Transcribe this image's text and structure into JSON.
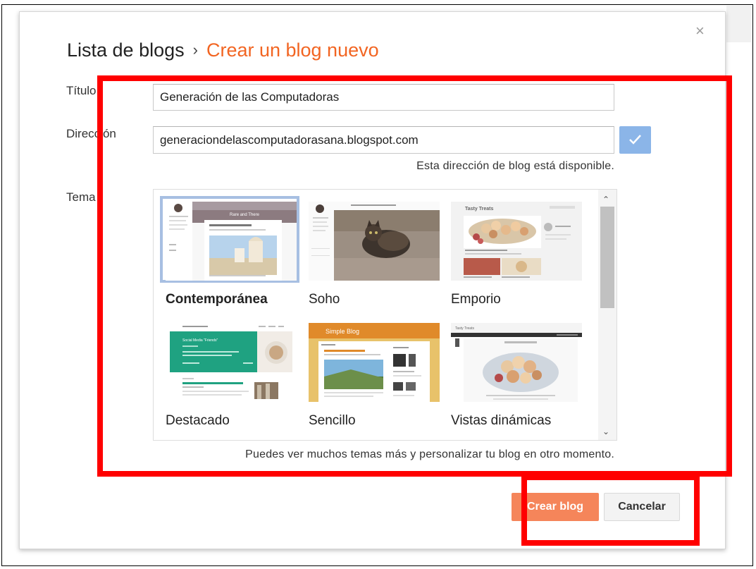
{
  "dialog": {
    "breadcrumb": {
      "parent": "Lista de blogs",
      "separator": "›",
      "current": "Crear un blog nuevo"
    },
    "close_icon": "×",
    "fields": {
      "title_label": "Título",
      "title_value": "Generación de las Computadoras",
      "address_label": "Dirección",
      "address_value": "generaciondelascomputadorasana.blogspot.com",
      "availability": "Esta dirección de blog está disponible.",
      "theme_label": "Tema"
    },
    "themes": [
      {
        "name": "Contemporánea",
        "selected": true
      },
      {
        "name": "Soho",
        "selected": false
      },
      {
        "name": "Emporio",
        "selected": false
      },
      {
        "name": "Destacado",
        "selected": false
      },
      {
        "name": "Sencillo",
        "selected": false
      },
      {
        "name": "Vistas dinámicas",
        "selected": false
      }
    ],
    "theme_thumbs": {
      "contemporanea_heading": "Rare and There",
      "emporio_heading": "Tasty Treats",
      "sencillo_heading": "Simple Blog",
      "destacado_heading": "Social Media \"Friends\"",
      "vistas_heading": "Tasty Treats"
    },
    "hint": "Puedes ver muchos temas más y personalizar tu blog en otro momento.",
    "buttons": {
      "create": "Crear blog",
      "cancel": "Cancelar"
    }
  },
  "colors": {
    "accent": "#f26522",
    "annotation": "#ff0000",
    "check_button": "#8bb5e8",
    "selected_border": "#a7bfe2"
  }
}
